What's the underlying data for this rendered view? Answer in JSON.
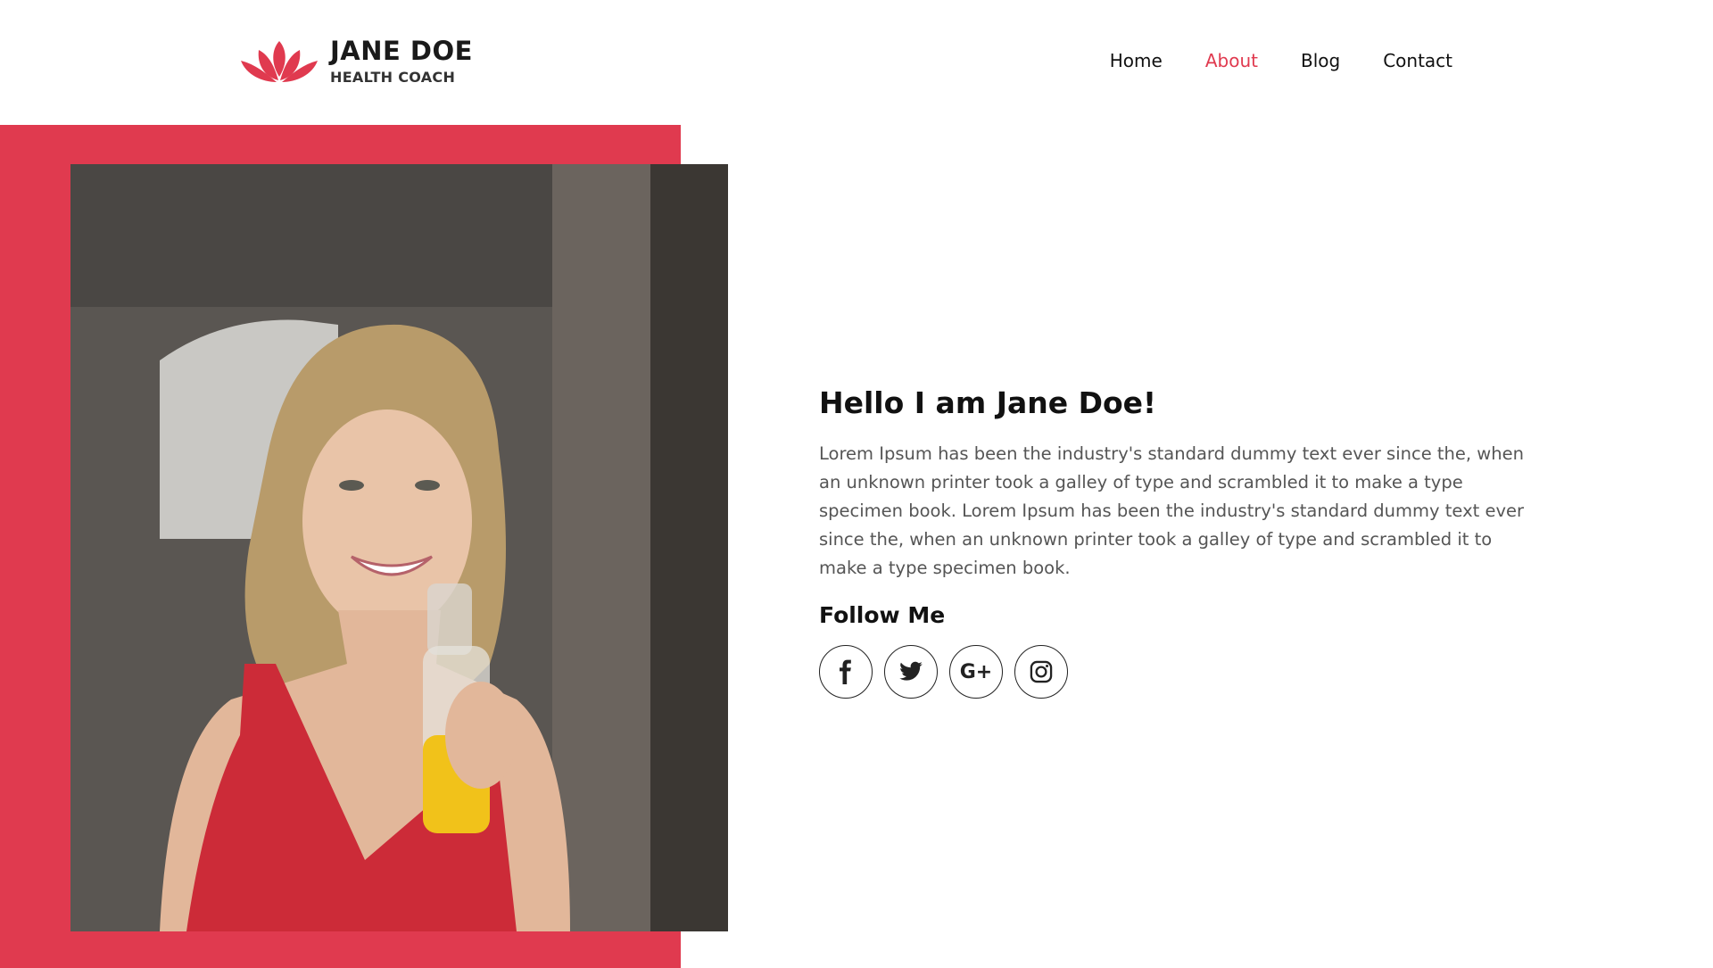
{
  "brand": {
    "name": "JANE DOE",
    "subtitle": "HEALTH COACH",
    "accent": "#e03a4f"
  },
  "nav": {
    "items": [
      {
        "label": "Home",
        "active": false
      },
      {
        "label": "About",
        "active": true
      },
      {
        "label": "Blog",
        "active": false
      },
      {
        "label": "Contact",
        "active": false
      }
    ]
  },
  "about": {
    "heading": "Hello I am Jane Doe!",
    "bio": "Lorem Ipsum has been the industry's standard dummy text ever since the, when an unknown printer took a galley of type and scrambled it to make a type specimen book. Lorem Ipsum has been the industry's standard dummy text ever since the, when an unknown printer took a galley of type and scrambled it to make a type specimen book.",
    "follow_heading": "Follow Me"
  },
  "social": [
    {
      "icon": "facebook-icon"
    },
    {
      "icon": "twitter-icon"
    },
    {
      "icon": "google-plus-icon",
      "text": "G+"
    },
    {
      "icon": "instagram-icon"
    }
  ]
}
